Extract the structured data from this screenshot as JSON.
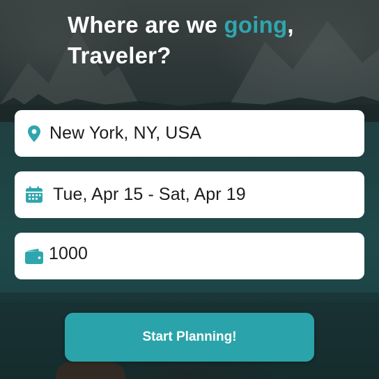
{
  "colors": {
    "accent": "#2fa6ad",
    "button": "#2aa4aa",
    "field_bg": "#ffffff",
    "text_dark": "#1c1c1c",
    "headline": "#ffffff"
  },
  "headline": {
    "prefix": "Where are we ",
    "highlight": "going",
    "comma": ",",
    "line2": "Traveler?"
  },
  "form": {
    "location": {
      "value": "New York, NY, USA",
      "icon": "map-pin-icon"
    },
    "dates": {
      "value": "Tue, Apr 15 - Sat, Apr 19",
      "icon": "calendar-icon"
    },
    "budget": {
      "value": "1000",
      "icon": "wallet-icon"
    }
  },
  "cta": {
    "label": "Start Planning!"
  }
}
